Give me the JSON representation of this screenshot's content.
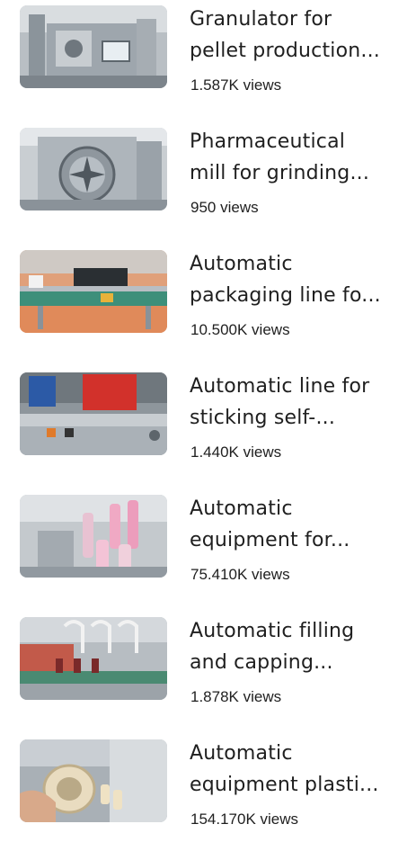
{
  "videos": [
    {
      "title_line1": "Granulator for",
      "title_line2": "pellet production...",
      "views": "1.587K views",
      "thumbnail_icon": "granulator-machine-thumbnail"
    },
    {
      "title_line1": "Pharmaceutical",
      "title_line2": "mill for grinding...",
      "views": "950 views",
      "thumbnail_icon": "pharmaceutical-mill-thumbnail"
    },
    {
      "title_line1": "Automatic",
      "title_line2": "packaging line fo...",
      "views": "10.500K views",
      "thumbnail_icon": "packaging-line-thumbnail"
    },
    {
      "title_line1": "Automatic line for",
      "title_line2": "sticking self-...",
      "views": "1.440K views",
      "thumbnail_icon": "labeling-line-thumbnail"
    },
    {
      "title_line1": "Automatic",
      "title_line2": "equipment for...",
      "views": "75.410K views",
      "thumbnail_icon": "tube-equipment-thumbnail"
    },
    {
      "title_line1": "Automatic filling",
      "title_line2": "and capping...",
      "views": "1.878K views",
      "thumbnail_icon": "filling-capping-thumbnail"
    },
    {
      "title_line1": "Automatic",
      "title_line2": "equipment plasti...",
      "views": "154.170K views",
      "thumbnail_icon": "plastic-equipment-thumbnail"
    }
  ]
}
